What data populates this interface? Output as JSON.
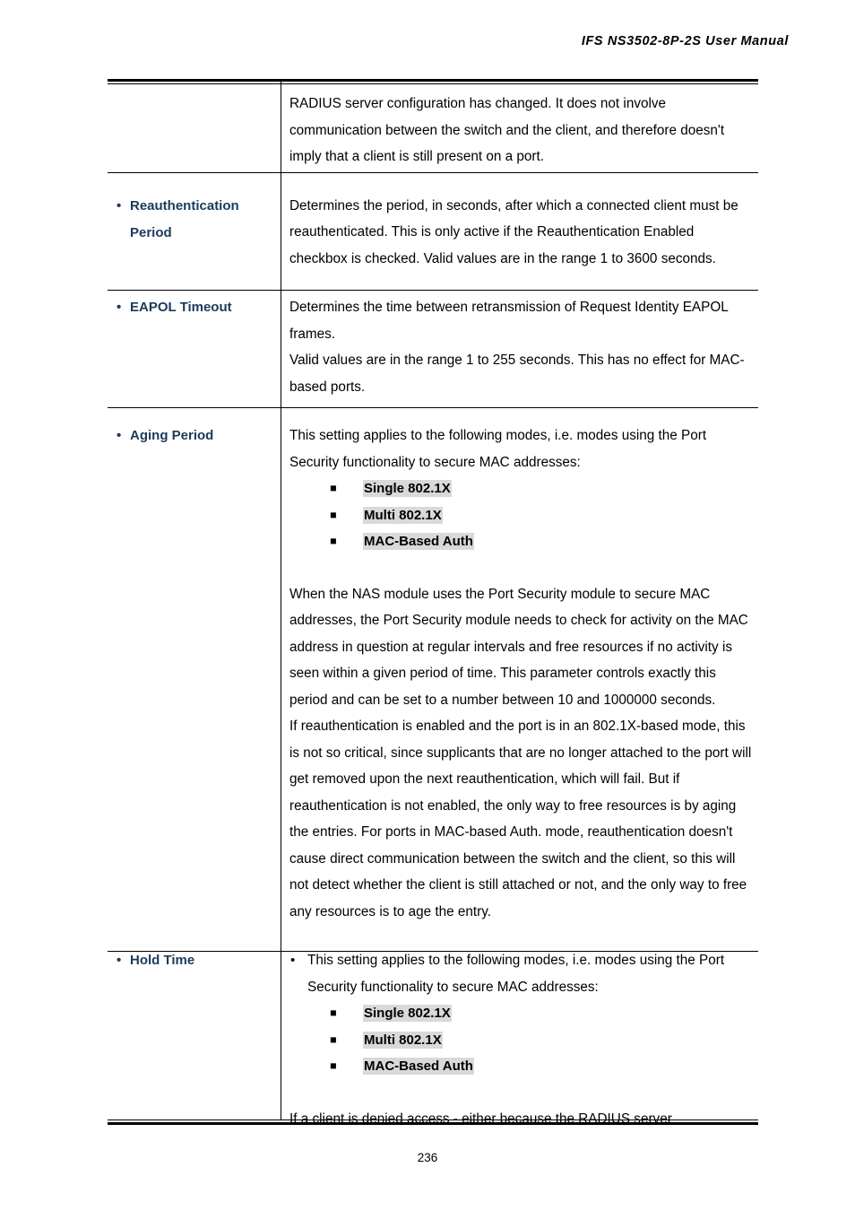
{
  "document": {
    "header_title": "IFS  NS3502-8P-2S  User  Manual",
    "page_number": "236"
  },
  "colors": {
    "label_text": "#1b3a5c",
    "highlight": "#d9d9d9",
    "rule": "#000000"
  },
  "icons": {
    "round_bullet": "•",
    "square_bullet": "■"
  },
  "table": {
    "rows": [
      {
        "label": null,
        "label_continued": true,
        "paragraphs": [
          "RADIUS server configuration has changed. It does not involve communication between the switch and the client, and therefore doesn't imply that a client is still present on a port."
        ]
      },
      {
        "label": "Reauthentication Period",
        "paragraphs": [
          "Determines the period, in seconds, after which a connected client must be reauthenticated. This is only active if the Reauthentication Enabled checkbox is checked. Valid values are in the range 1 to 3600 seconds."
        ]
      },
      {
        "label": "EAPOL Timeout",
        "paragraphs": [
          "Determines the time between retransmission of Request Identity EAPOL frames.",
          "Valid values are in the range 1 to 255 seconds. This has no effect for MAC-based ports."
        ]
      },
      {
        "label": "Aging Period",
        "intro": "This setting applies to the following modes, i.e. modes using the Port Security functionality to secure MAC addresses:",
        "modes": [
          "Single 802.1X",
          "Multi 802.1X",
          "MAC-Based Auth"
        ],
        "paragraphs": [
          "When the NAS module uses the Port Security module to secure MAC addresses, the Port Security module needs to check for activity on the MAC address in question at regular intervals and free resources if no activity is seen within a given period of time. This parameter controls exactly this period and can be set to a number between 10 and 1000000 seconds.",
          "If reauthentication is enabled and the port is in an 802.1X-based mode, this is not so critical, since supplicants that are no longer attached to the port will get removed upon the next reauthentication, which will fail. But if reauthentication is not enabled, the only way to free resources is by aging the entries. For ports in MAC-based Auth. mode, reauthentication doesn't cause direct communication between the switch and the client, so this will not detect whether the client is still attached or not, and the only way to free any resources is to age the entry."
        ]
      },
      {
        "label": "Hold Time",
        "intro": "This setting applies to the following modes, i.e. modes using the Port Security functionality to secure MAC addresses:",
        "intro_bulleted": true,
        "modes": [
          "Single 802.1X",
          "Multi 802.1X",
          "MAC-Based Auth"
        ],
        "paragraphs": [
          "If a client is denied access - either because the RADIUS server"
        ]
      }
    ]
  }
}
